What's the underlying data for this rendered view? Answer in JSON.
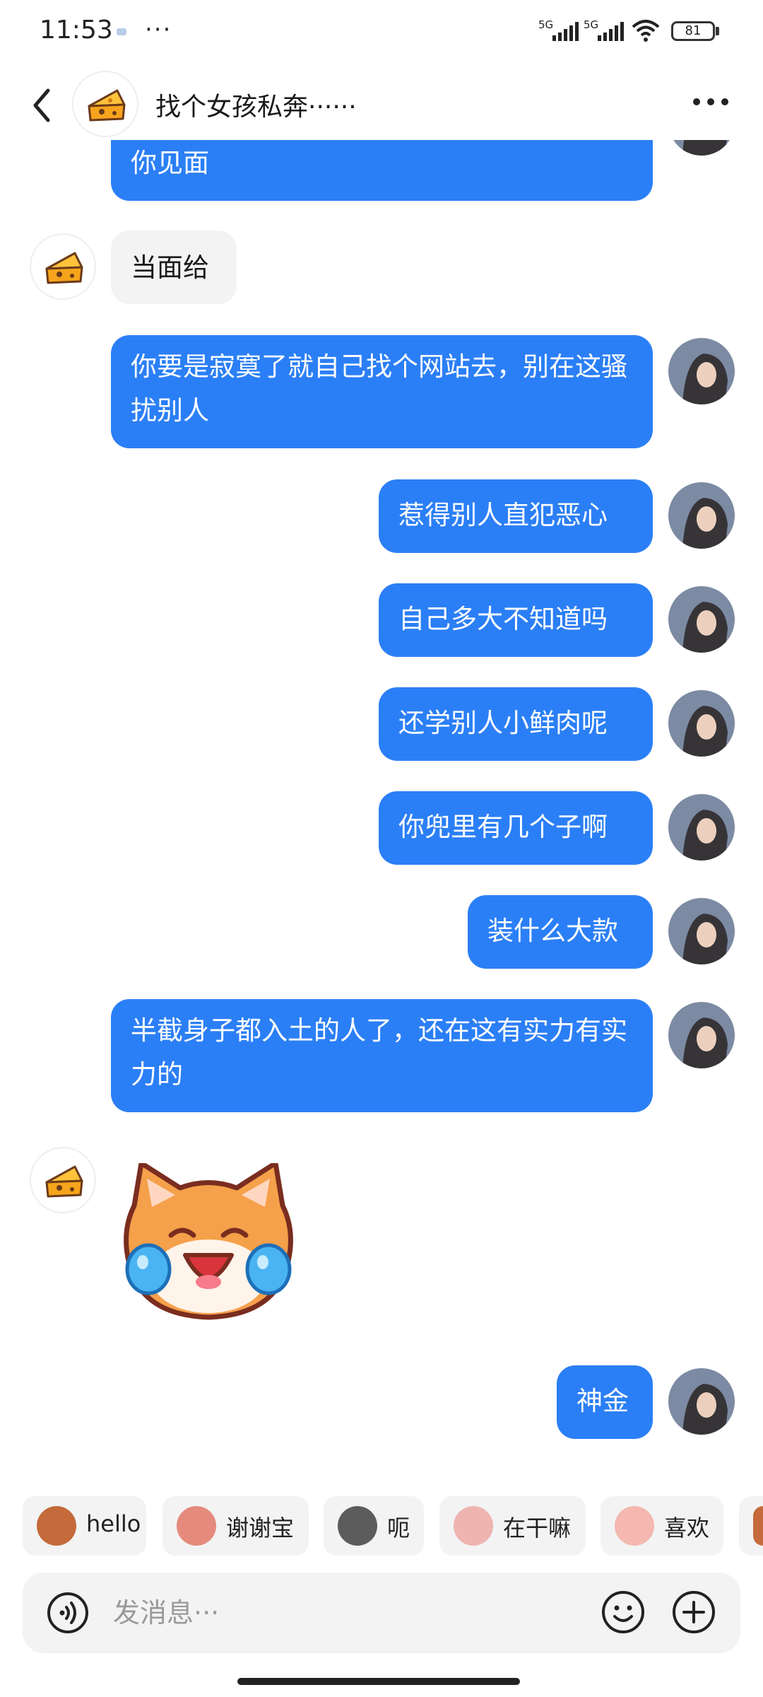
{
  "status_bar": {
    "time": "11:53",
    "more": "···",
    "sig1_label": "5G",
    "sig2_label": "5G",
    "battery": "81"
  },
  "header": {
    "title": "找个女孩私奔······",
    "back_icon": "chevron-left-icon",
    "more_icon": "more-dots-icon"
  },
  "messages": [
    {
      "side": "out",
      "text": "你见面"
    },
    {
      "side": "in",
      "text": "当面给"
    },
    {
      "side": "out",
      "text": "你要是寂寞了就自己找个网站去，别在这骚扰别人"
    },
    {
      "side": "out",
      "text": "惹得别人直犯恶心"
    },
    {
      "side": "out",
      "text": "自己多大不知道吗"
    },
    {
      "side": "out",
      "text": "还学别人小鲜肉呢"
    },
    {
      "side": "out",
      "text": "你兜里有几个子啊"
    },
    {
      "side": "out",
      "text": "装什么大款"
    },
    {
      "side": "out",
      "text": "半截身子都入土的人了，还在这有实力有实力的"
    },
    {
      "side": "in",
      "sticker": "laughing-crying-cat-sticker"
    },
    {
      "side": "out",
      "text": "神金"
    }
  ],
  "quick_replies": [
    {
      "label": "hello",
      "icon": "monkey-icon"
    },
    {
      "label": "谢谢宝",
      "icon": "girl-flower-icon"
    },
    {
      "label": "呃",
      "icon": "cat-speechless-icon"
    },
    {
      "label": "在干嘛",
      "icon": "magnifier-face-icon"
    },
    {
      "label": "喜欢",
      "icon": "pig-love-icon"
    }
  ],
  "composer": {
    "placeholder": "发消息···",
    "voice_icon": "voice-icon",
    "emoji_icon": "emoji-icon",
    "plus_icon": "plus-icon"
  },
  "colors": {
    "outgoing_bubble": "#2b7ff6",
    "incoming_bubble": "#f3f3f3",
    "background": "#ffffff"
  }
}
